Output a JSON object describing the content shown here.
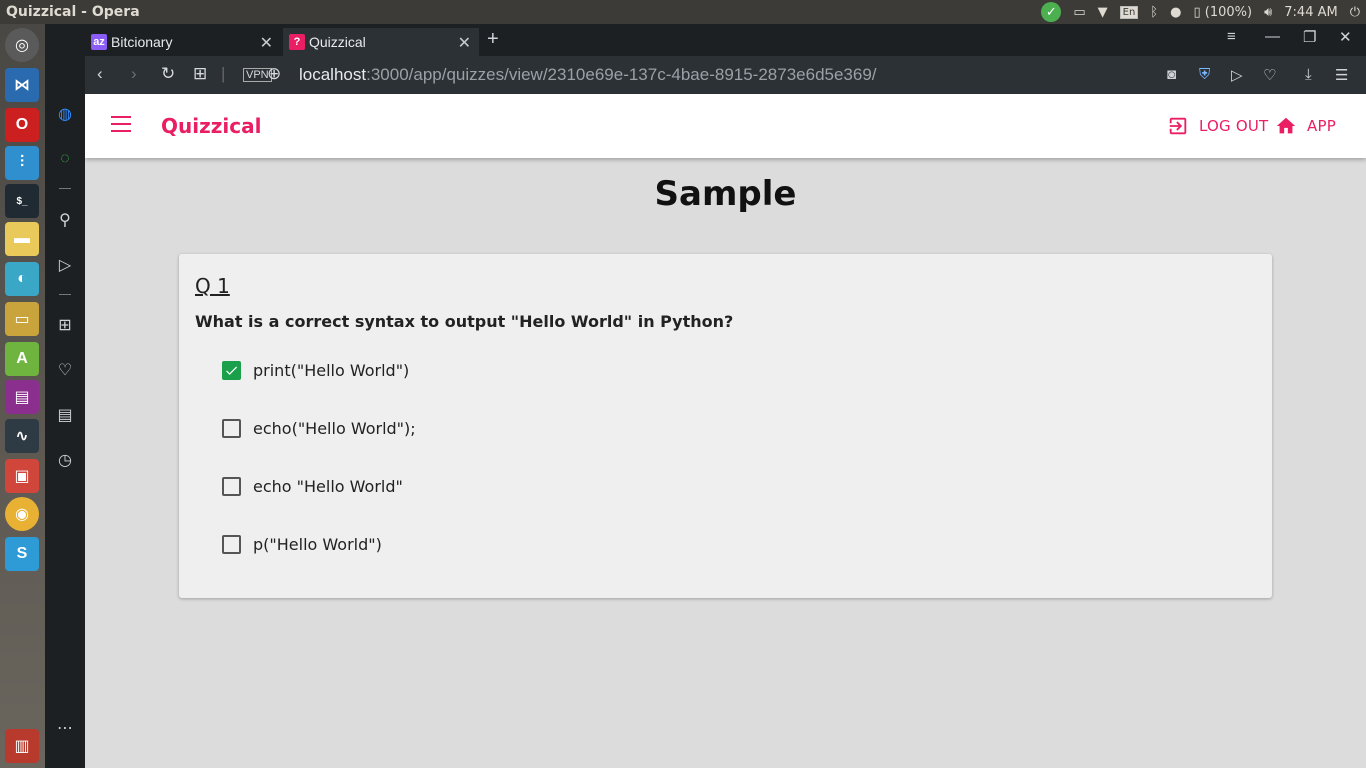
{
  "os": {
    "window_title": "Quizzical - Opera",
    "battery": "(100%)",
    "time": "7:44 AM",
    "keyboard": "En"
  },
  "browser": {
    "tabs": [
      {
        "label": "Bitcionary",
        "favicon": "az-icon",
        "active": false
      },
      {
        "label": "Quizzical",
        "favicon": "question-icon",
        "active": true
      }
    ],
    "url_host": "localhost",
    "url_path": ":3000/app/quizzes/view/2310e69e-137c-4bae-8915-2873e6d5e369/"
  },
  "app": {
    "brand": "Quizzical",
    "logout_label": "LOG OUT",
    "app_label": "APP",
    "accent_color": "#e91e63"
  },
  "quiz": {
    "title": "Sample",
    "question_number": "Q 1",
    "question_text": "What is a correct syntax to output \"Hello World\" in Python?",
    "options": [
      {
        "label": "print(\"Hello World\")",
        "checked": true
      },
      {
        "label": "echo(\"Hello World\");",
        "checked": false
      },
      {
        "label": "echo \"Hello World\"",
        "checked": false
      },
      {
        "label": "p(\"Hello World\")",
        "checked": false
      }
    ],
    "checked_color": "#1aa04a"
  }
}
